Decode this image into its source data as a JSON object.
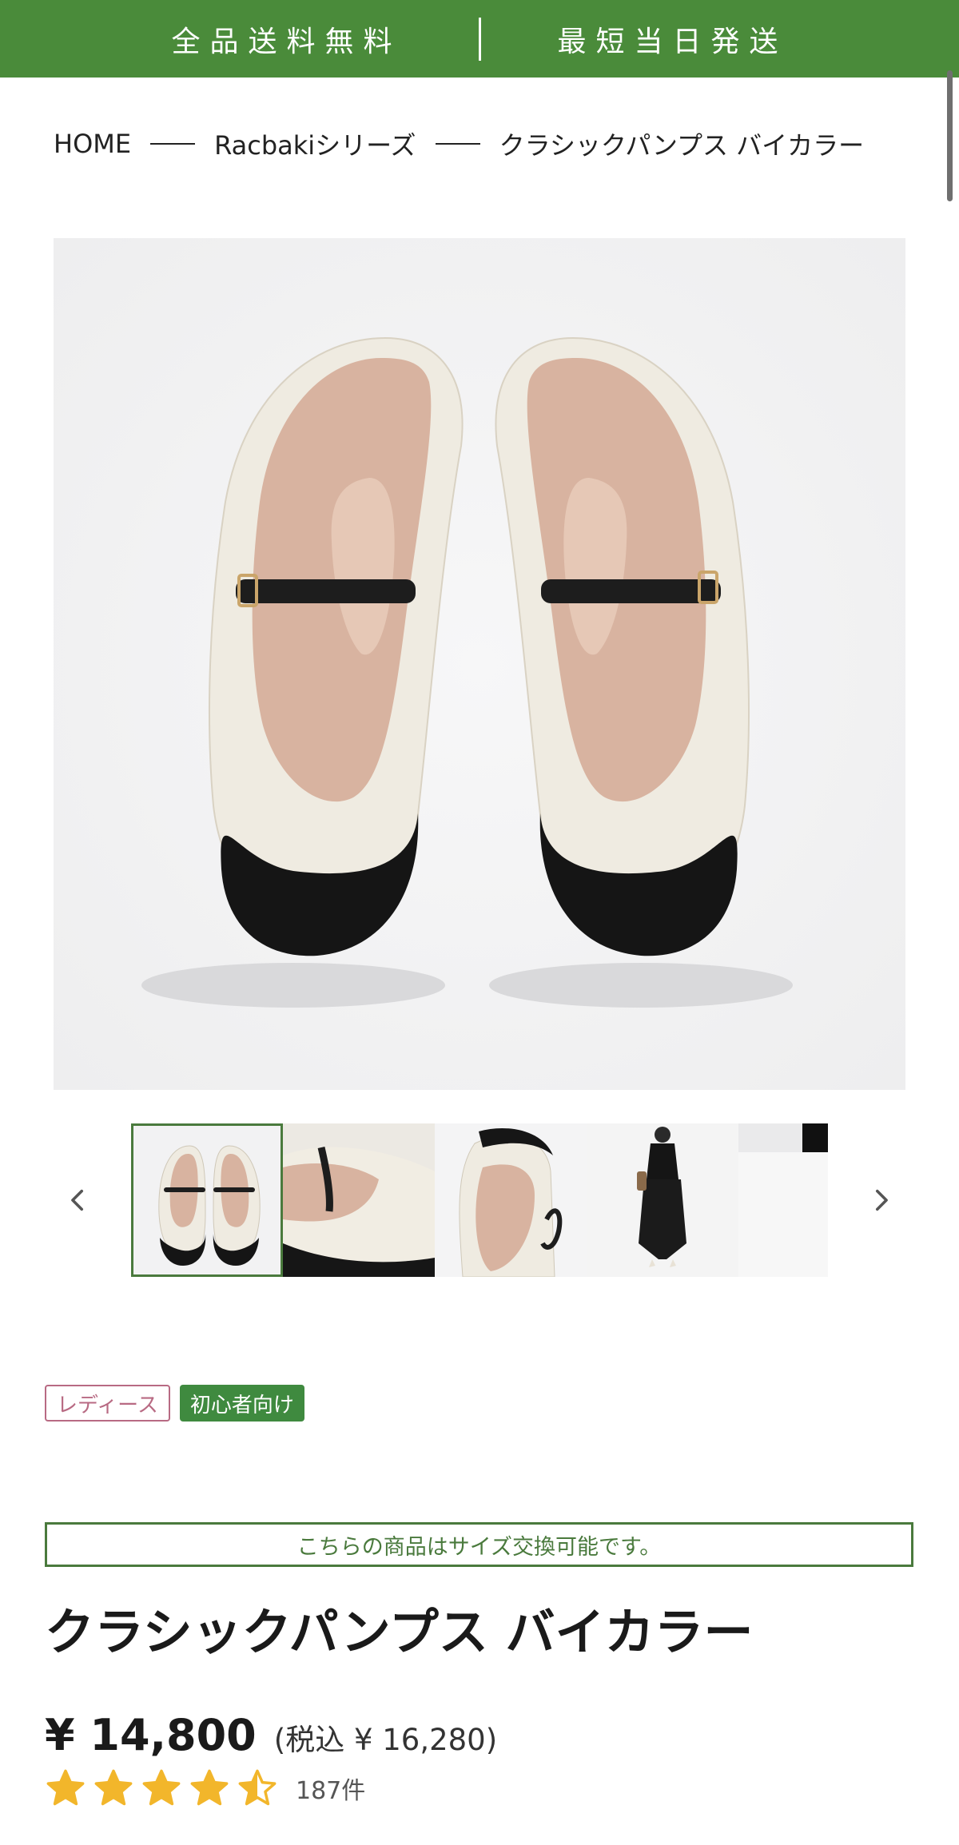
{
  "announcement": {
    "free_shipping": "全品送料無料",
    "same_day": "最短当日発送"
  },
  "breadcrumb": {
    "home": "HOME",
    "series": "Racbakiシリーズ",
    "current": "クラシックパンプス バイカラー"
  },
  "gallery": {
    "prev_icon": "chevron-left-icon",
    "next_icon": "chevron-right-icon",
    "selected_index": 0,
    "thumbnail_count": 5
  },
  "tags": [
    "レディース",
    "初心者向け"
  ],
  "notice": "こちらの商品はサイズ交換可能です。",
  "product": {
    "title": "クラシックパンプス バイカラー",
    "price": "¥ 14,800",
    "price_tax_included": "(税込 ¥ 16,280)",
    "rating": 4.5,
    "rating_max": 5,
    "review_count": "187件"
  },
  "colors": {
    "brand_green": "#4a8b3a",
    "tag_pink": "#b86a83",
    "star_gold": "#f2b62b"
  }
}
